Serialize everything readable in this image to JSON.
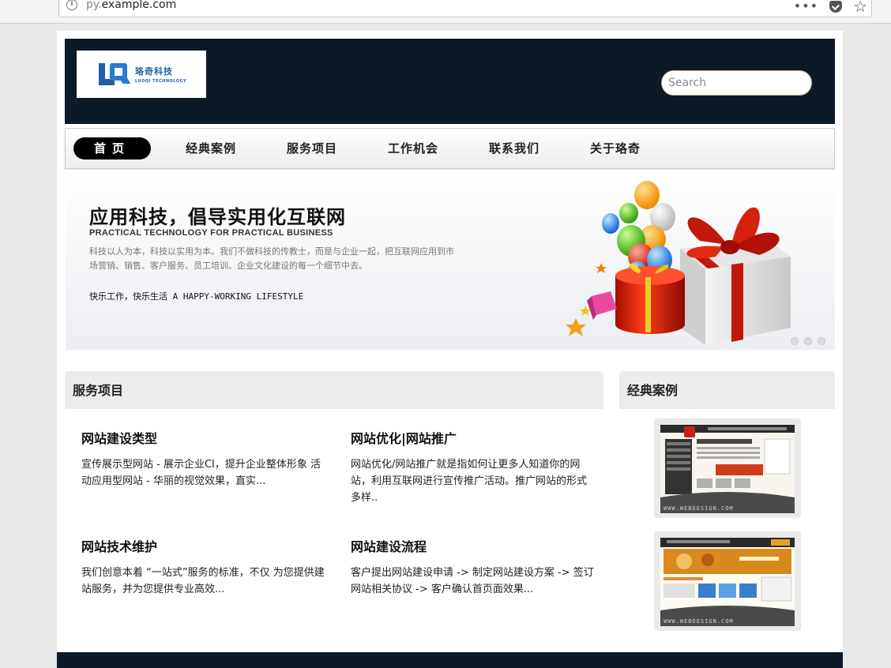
{
  "browser": {
    "url_prefix": "py.",
    "url_domain": "example.com",
    "menu_dots": "•••"
  },
  "brand": {
    "name_cn": "珞奇科技",
    "name_en": "LUOQI TECHNOLOGY",
    "primary_color": "#0c1a28",
    "logo_color": "#1f5fa8"
  },
  "search": {
    "placeholder": "Search"
  },
  "nav": {
    "items": [
      {
        "label": "首页",
        "active": true
      },
      {
        "label": "经典案例"
      },
      {
        "label": "服务项目"
      },
      {
        "label": "工作机会"
      },
      {
        "label": "联系我们"
      },
      {
        "label": "关于珞奇"
      }
    ]
  },
  "banner": {
    "title": "应用科技，倡导实用化互联网",
    "subtitle": "PRACTICAL TECHNOLOGY FOR PRACTICAL BUSINESS",
    "desc_line1": "科技以人为本，科技以实用为本。我们不做科技的传教士，而是与企业一起，把互联网应用到市",
    "desc_line2": "场营销、销售、客户服务、员工培训、企业文化建设的每一个细节中去。",
    "slogan": "快乐工作，快乐生活 A HAPPY-WORKING LIFESTYLE"
  },
  "services": {
    "heading": "服务项目",
    "items": [
      {
        "title": "网站建设类型",
        "text": "宣传展示型网站 - 展示企业CI，提升企业整体形象 活动应用型网站 - 华丽的视觉效果，直实..."
      },
      {
        "title": "网站优化|网站推广",
        "text": "网站优化/网站推广就是指如何让更多人知道你的网站，利用互联网进行宣传推广活动。推广网站的形式多样.."
      },
      {
        "title": "网站技术维护",
        "text": "我们创意本着 “一站式”服务的标准，不仅 为您提供建站服务，并为您提供专业高效..."
      },
      {
        "title": "网站建设流程",
        "text": "客户提出网站建设申请 -> 制定网站建设方案 -> 签订网站相关协议 -> 客户确认首页面效果..."
      }
    ]
  },
  "cases": {
    "heading": "经典案例",
    "thumbs": [
      {
        "caption": "WWW.WEBDESIGN.COM"
      },
      {
        "caption": "WWW.WEBDESIGN.COM"
      }
    ]
  }
}
